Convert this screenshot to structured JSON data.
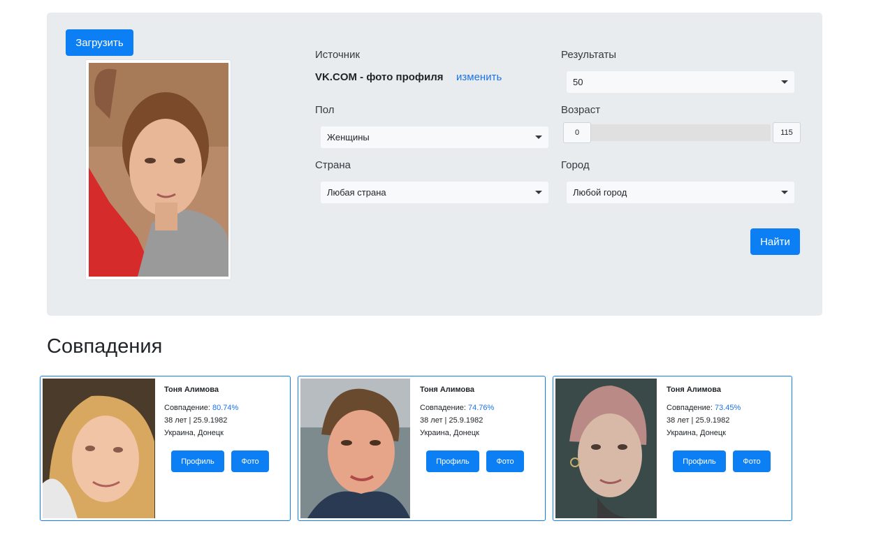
{
  "search": {
    "upload_label": "Загрузить",
    "source_label": "Источник",
    "source_value": "VK.COM - фото профиля",
    "change_label": "изменить",
    "results_label": "Результаты",
    "results_value": "50",
    "gender_label": "Пол",
    "gender_value": "Женщины",
    "age_label": "Возраст",
    "age_min": "0",
    "age_max": "115",
    "country_label": "Страна",
    "country_value": "Любая страна",
    "city_label": "Город",
    "city_value": "Любой город",
    "find_label": "Найти"
  },
  "matches": {
    "heading": "Совпадения",
    "match_prefix": "Совпадение: ",
    "profile_label": "Профиль",
    "photo_label": "Фото",
    "items": [
      {
        "name": "Тоня Алимова",
        "percent": "80.74%",
        "age_birth": "38 лет | 25.9.1982",
        "location": "Украина, Донецк"
      },
      {
        "name": "Тоня Алимова",
        "percent": "74.76%",
        "age_birth": "38 лет | 25.9.1982",
        "location": "Украина, Донецк"
      },
      {
        "name": "Тоня Алимова",
        "percent": "73.45%",
        "age_birth": "38 лет | 25.9.1982",
        "location": "Украина, Донецк"
      }
    ]
  },
  "colors": {
    "primary": "#0d7ff5",
    "link": "#1a73e8",
    "panel_bg": "#e9ecef"
  }
}
